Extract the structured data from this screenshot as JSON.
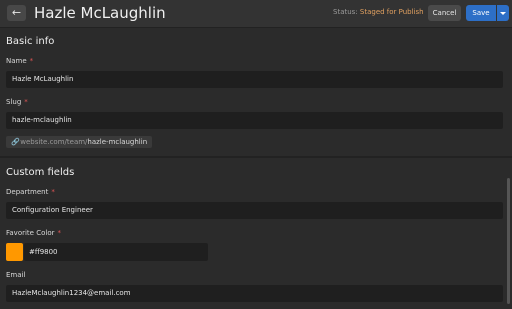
{
  "header": {
    "back_icon": "arrow-left-icon",
    "title": "Hazle McLaughlin",
    "status_label": "Status:",
    "status_value": "Staged for Publish",
    "cancel_label": "Cancel",
    "save_label": "Save"
  },
  "basic_info": {
    "section_title": "Basic info",
    "name": {
      "label": "Name",
      "required": "*",
      "value": "Hazle McLaughlin"
    },
    "slug": {
      "label": "Slug",
      "required": "*",
      "value": "hazle-mclaughlin"
    },
    "url_prefix": "website.com/team/",
    "url_slug": "hazle-mclaughlin"
  },
  "custom_fields": {
    "section_title": "Custom fields",
    "department": {
      "label": "Department",
      "required": "*",
      "value": "Configuration Engineer"
    },
    "favorite_color": {
      "label": "Favorite Color",
      "required": "*",
      "value": "#ff9800",
      "swatch": "#ff9800"
    },
    "email": {
      "label": "Email",
      "value": "HazleMclaughlin1234@email.com"
    }
  },
  "colors": {
    "primary_button": "#2d6fc7",
    "status_accent": "#e0a060",
    "required_marker": "#e05555"
  }
}
